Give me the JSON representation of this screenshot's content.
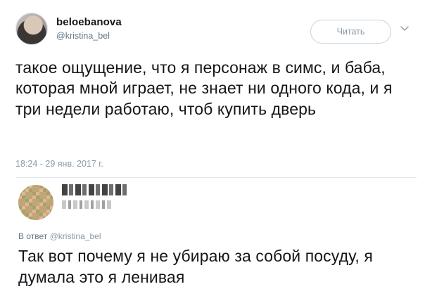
{
  "tweet": {
    "author": {
      "display_name": "beloebanova",
      "handle": "@kristina_bel"
    },
    "follow_label": "Читать",
    "text": "такое ощущение, что я персонаж в симс, и баба, которая мной играет, не знает ни одного кода, и я три недели работаю, чтоб купить дверь",
    "timestamp": "18:24 - 29 янв. 2017 г."
  },
  "reply": {
    "context_prefix": "В ответ",
    "context_handle": "@kristina_bel",
    "text": "Так вот почему я не убираю за собой посуду, я думала это я ленивая"
  },
  "icons": {
    "caret": "chevron-down-icon"
  },
  "colors": {
    "text": "#14171a",
    "secondary": "#657786",
    "muted": "#8899a6",
    "divider": "#e1e8ed"
  }
}
